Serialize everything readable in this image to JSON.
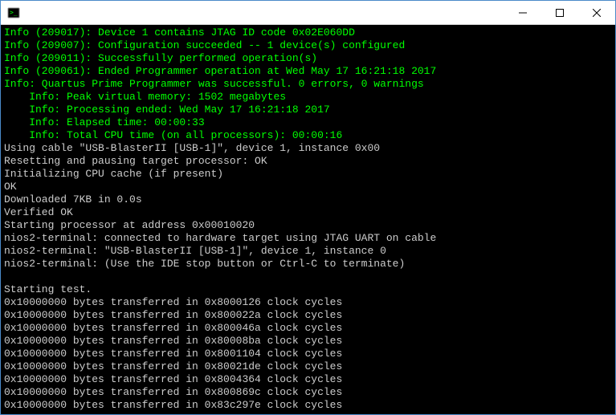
{
  "titlebar": {
    "title": ""
  },
  "terminal": {
    "lines": [
      {
        "cls": "green",
        "text": "Info (209017): Device 1 contains JTAG ID code 0x02E060DD"
      },
      {
        "cls": "green",
        "text": "Info (209007): Configuration succeeded -- 1 device(s) configured"
      },
      {
        "cls": "green",
        "text": "Info (209011): Successfully performed operation(s)"
      },
      {
        "cls": "green",
        "text": "Info (209061): Ended Programmer operation at Wed May 17 16:21:18 2017"
      },
      {
        "cls": "green",
        "text": "Info: Quartus Prime Programmer was successful. 0 errors, 0 warnings"
      },
      {
        "cls": "green",
        "text": "    Info: Peak virtual memory: 1502 megabytes"
      },
      {
        "cls": "green",
        "text": "    Info: Processing ended: Wed May 17 16:21:18 2017"
      },
      {
        "cls": "green",
        "text": "    Info: Elapsed time: 00:00:33"
      },
      {
        "cls": "green",
        "text": "    Info: Total CPU time (on all processors): 00:00:16"
      },
      {
        "cls": "white",
        "text": "Using cable \"USB-BlasterII [USB-1]\", device 1, instance 0x00"
      },
      {
        "cls": "white",
        "text": "Resetting and pausing target processor: OK"
      },
      {
        "cls": "white",
        "text": "Initializing CPU cache (if present)"
      },
      {
        "cls": "white",
        "text": "OK"
      },
      {
        "cls": "white",
        "text": "Downloaded 7KB in 0.0s"
      },
      {
        "cls": "white",
        "text": "Verified OK"
      },
      {
        "cls": "white",
        "text": "Starting processor at address 0x00010020"
      },
      {
        "cls": "white",
        "text": "nios2-terminal: connected to hardware target using JTAG UART on cable"
      },
      {
        "cls": "white",
        "text": "nios2-terminal: \"USB-BlasterII [USB-1]\", device 1, instance 0"
      },
      {
        "cls": "white",
        "text": "nios2-terminal: (Use the IDE stop button or Ctrl-C to terminate)"
      },
      {
        "cls": "white",
        "text": ""
      },
      {
        "cls": "white",
        "text": "Starting test."
      },
      {
        "cls": "white",
        "text": "0x10000000 bytes transferred in 0x8000126 clock cycles"
      },
      {
        "cls": "white",
        "text": "0x10000000 bytes transferred in 0x800022a clock cycles"
      },
      {
        "cls": "white",
        "text": "0x10000000 bytes transferred in 0x800046a clock cycles"
      },
      {
        "cls": "white",
        "text": "0x10000000 bytes transferred in 0x80008ba clock cycles"
      },
      {
        "cls": "white",
        "text": "0x10000000 bytes transferred in 0x8001104 clock cycles"
      },
      {
        "cls": "white",
        "text": "0x10000000 bytes transferred in 0x80021de clock cycles"
      },
      {
        "cls": "white",
        "text": "0x10000000 bytes transferred in 0x8004364 clock cycles"
      },
      {
        "cls": "white",
        "text": "0x10000000 bytes transferred in 0x800869c clock cycles"
      },
      {
        "cls": "white",
        "text": "0x10000000 bytes transferred in 0x83c297e clock cycles"
      }
    ]
  }
}
